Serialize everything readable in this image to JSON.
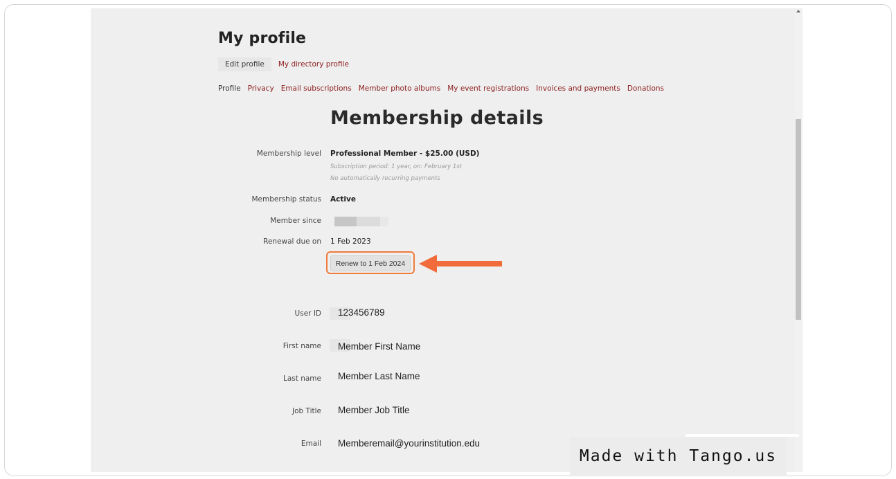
{
  "header": {
    "page_title": "My profile"
  },
  "tabs": [
    {
      "label": "Edit profile"
    },
    {
      "label": "My directory profile"
    }
  ],
  "subnav": [
    {
      "label": "Profile"
    },
    {
      "label": "Privacy"
    },
    {
      "label": "Email subscriptions"
    },
    {
      "label": "Member photo albums"
    },
    {
      "label": "My event registrations"
    },
    {
      "label": "Invoices and payments"
    },
    {
      "label": "Donations"
    }
  ],
  "membership": {
    "title": "Membership details",
    "level_label": "Membership level",
    "level_value": "Professional Member - $25.00 (USD)",
    "period_note": "Subscription period: 1 year, on: February 1st",
    "recurring_note": "No automatically recurring payments",
    "status_label": "Membership status",
    "status_value": "Active",
    "since_label": "Member since",
    "renewal_label": "Renewal due on",
    "renewal_value": "1 Feb 2023",
    "renew_button": "Renew to 1 Feb 2024"
  },
  "fields": [
    {
      "label": "User ID",
      "value": "123456789"
    },
    {
      "label": "First name",
      "value": "Member First Name"
    },
    {
      "label": "Last name",
      "value": "Member Last Name"
    },
    {
      "label": "Job Title",
      "value": "Member Job Title"
    },
    {
      "label": "Email",
      "value": "Memberemail@yourinstitution.edu"
    }
  ],
  "colors": {
    "link": "#8c1d1d",
    "highlight": "#f07a3a",
    "arrow": "#f26b3a"
  },
  "watermark": "Made with Tango.us"
}
